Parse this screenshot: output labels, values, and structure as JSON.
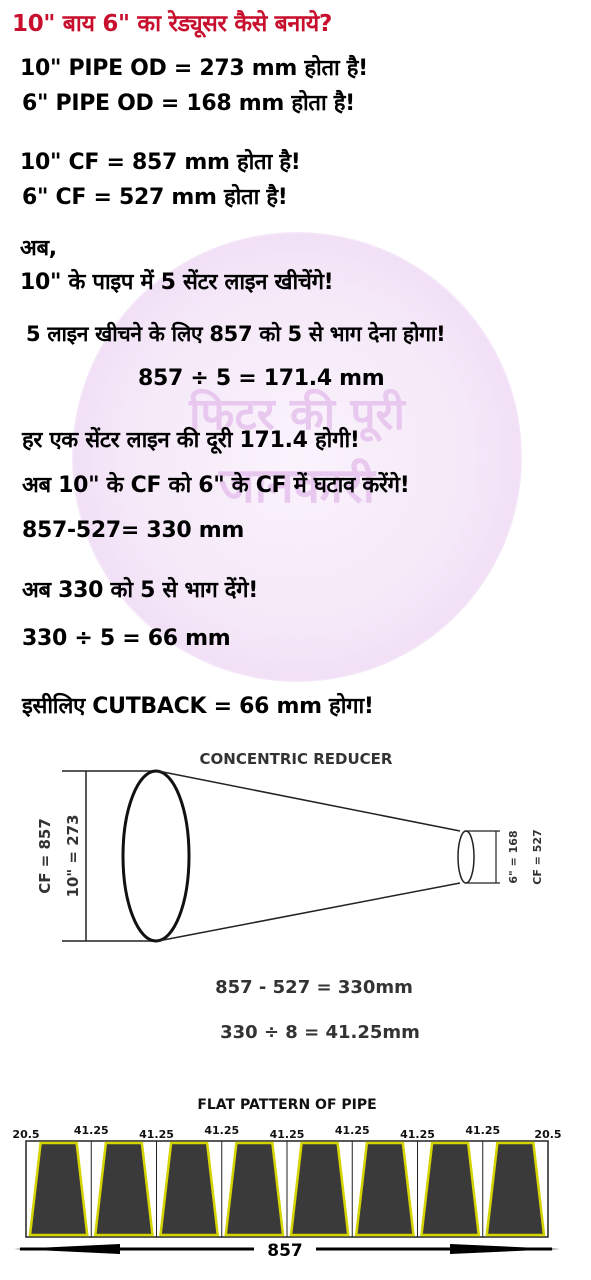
{
  "title": "10\" बाय 6\" का रेड्यूसर कैसे बनाये?",
  "lines": {
    "od10": "10\" PIPE OD = 273 mm होता है!",
    "od6": "6\" PIPE OD = 168 mm होता है!",
    "cf10": "10\" CF = 857 mm होता है!",
    "cf6": "6\" CF = 527 mm होता है!",
    "ab": "अब,",
    "draw_lines": "10\" के पाइप में 5 सेंटर लाइन खीचेंगे!",
    "divide_857": "5 लाइन खीचने के लिए 857 को 5 से भाग देना होगा!",
    "calc_171": "857 ÷ 5 = 171.4 mm",
    "distance": "हर एक सेंटर लाइन की दूरी 171.4 होगी!",
    "subtract_cf": "अब 10\" के CF को 6\" के CF में घटाव करेंगे!",
    "calc_330": "857-527= 330 mm",
    "divide_330": "अब 330 को 5 से भाग देंगे!",
    "calc_66": "330 ÷ 5 = 66 mm",
    "cutback": "इसीलिए CUTBACK = 66 mm होगा!"
  },
  "watermark": {
    "line1": "फिटर की पूरी",
    "line2": "जानकारी"
  },
  "reducer_diagram": {
    "title": "CONCENTRIC REDUCER",
    "cf_large": "CF = 857",
    "od_large": "10\" = 273",
    "od_small": "6\" = 168",
    "cf_small": "CF = 527",
    "eq1": "857 - 527 = 330mm",
    "eq2": "330 ÷ 8 = 41.25mm"
  },
  "flat_pattern": {
    "title": "FLAT PATTERN OF PIPE",
    "top_labels": [
      "20.5",
      "41.25",
      "41.25",
      "41.25",
      "41.25",
      "41.25",
      "41.25",
      "41.25",
      "20.5"
    ],
    "total": "857"
  },
  "colors": {
    "title": "#c8102e",
    "text": "#000000",
    "segment_fill": "#3a3a3a",
    "segment_outline": "#d4d400",
    "watermark": "#f3e4f7"
  }
}
